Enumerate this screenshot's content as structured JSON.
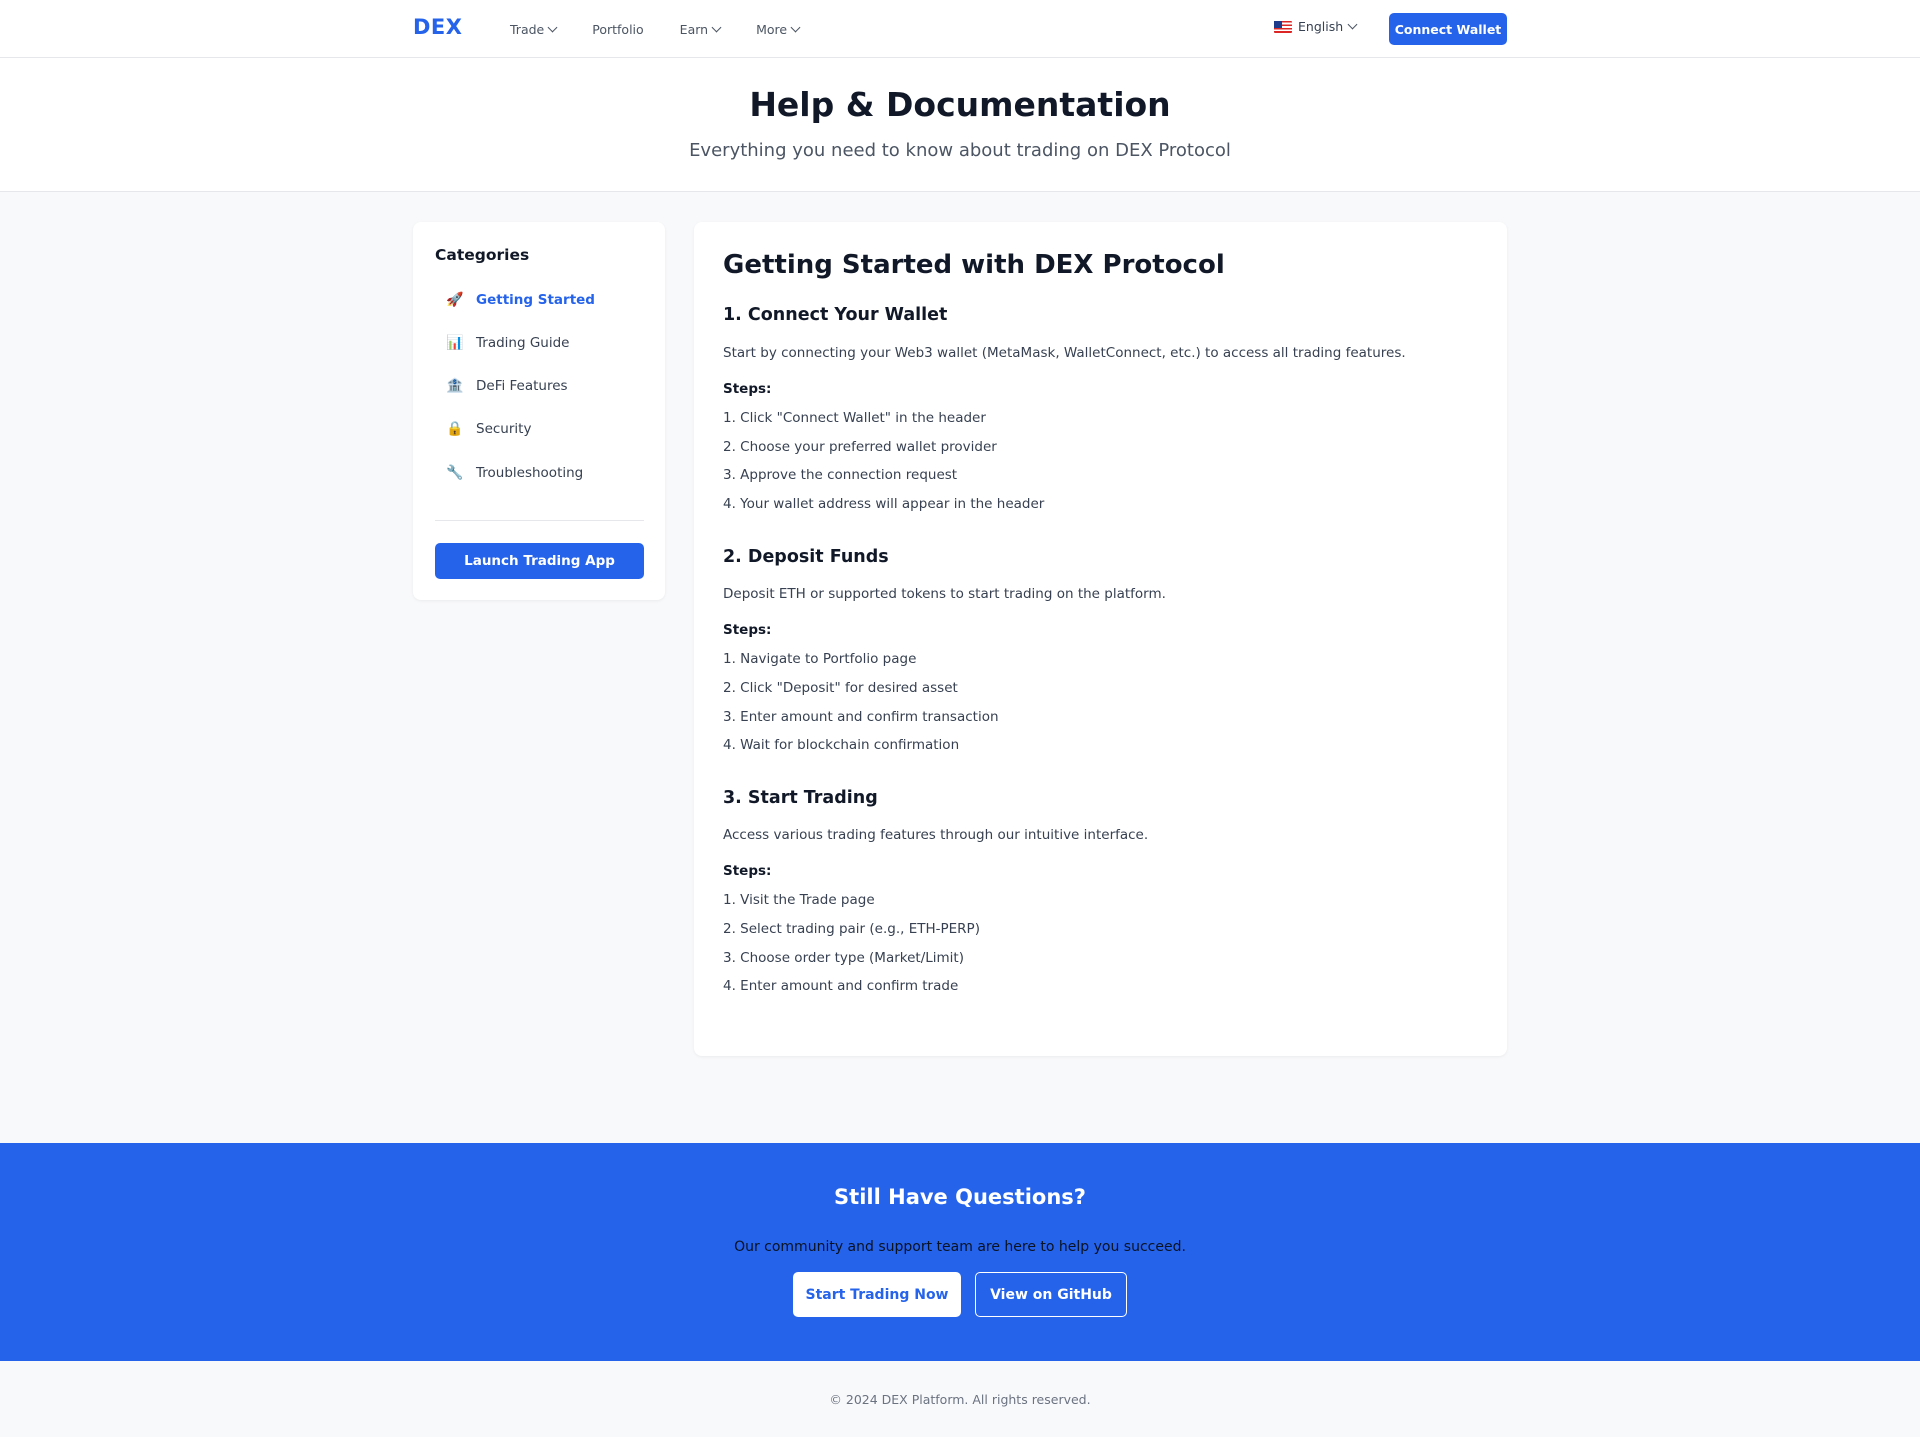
{
  "header": {
    "logo": "DEX",
    "nav": [
      {
        "label": "Trade",
        "dropdown": true
      },
      {
        "label": "Portfolio",
        "dropdown": false
      },
      {
        "label": "Earn",
        "dropdown": true
      },
      {
        "label": "More",
        "dropdown": true
      }
    ],
    "language": "English",
    "connect_label": "Connect Wallet"
  },
  "hero": {
    "title": "Help & Documentation",
    "subtitle": "Everything you need to know about trading on DEX Protocol"
  },
  "sidebar": {
    "heading": "Categories",
    "items": [
      {
        "icon": "🚀",
        "label": "Getting Started",
        "active": true
      },
      {
        "icon": "📊",
        "label": "Trading Guide",
        "active": false
      },
      {
        "icon": "🏦",
        "label": "DeFi Features",
        "active": false
      },
      {
        "icon": "🔒",
        "label": "Security",
        "active": false
      },
      {
        "icon": "🔧",
        "label": "Troubleshooting",
        "active": false
      }
    ],
    "launch_label": "Launch Trading App"
  },
  "content": {
    "title": "Getting Started with DEX Protocol",
    "sections": [
      {
        "title": "1. Connect Your Wallet",
        "desc": "Start by connecting your Web3 wallet (MetaMask, WalletConnect, etc.) to access all trading features.",
        "steps_label": "Steps:",
        "steps": [
          "1. Click \"Connect Wallet\" in the header",
          "2. Choose your preferred wallet provider",
          "3. Approve the connection request",
          "4. Your wallet address will appear in the header"
        ]
      },
      {
        "title": "2. Deposit Funds",
        "desc": "Deposit ETH or supported tokens to start trading on the platform.",
        "steps_label": "Steps:",
        "steps": [
          "1. Navigate to Portfolio page",
          "2. Click \"Deposit\" for desired asset",
          "3. Enter amount and confirm transaction",
          "4. Wait for blockchain confirmation"
        ]
      },
      {
        "title": "3. Start Trading",
        "desc": "Access various trading features through our intuitive interface.",
        "steps_label": "Steps:",
        "steps": [
          "1. Visit the Trade page",
          "2. Select trading pair (e.g., ETH-PERP)",
          "3. Choose order type (Market/Limit)",
          "4. Enter amount and confirm trade"
        ]
      }
    ]
  },
  "cta": {
    "title": "Still Have Questions?",
    "text": "Our community and support team are here to help you succeed.",
    "primary_label": "Start Trading Now",
    "secondary_label": "View on GitHub"
  },
  "footer": {
    "copyright": "© 2024 DEX Platform. All rights reserved."
  },
  "colors": {
    "accent": "#2563eb",
    "background": "#f8f9fb",
    "text": "#111827"
  }
}
